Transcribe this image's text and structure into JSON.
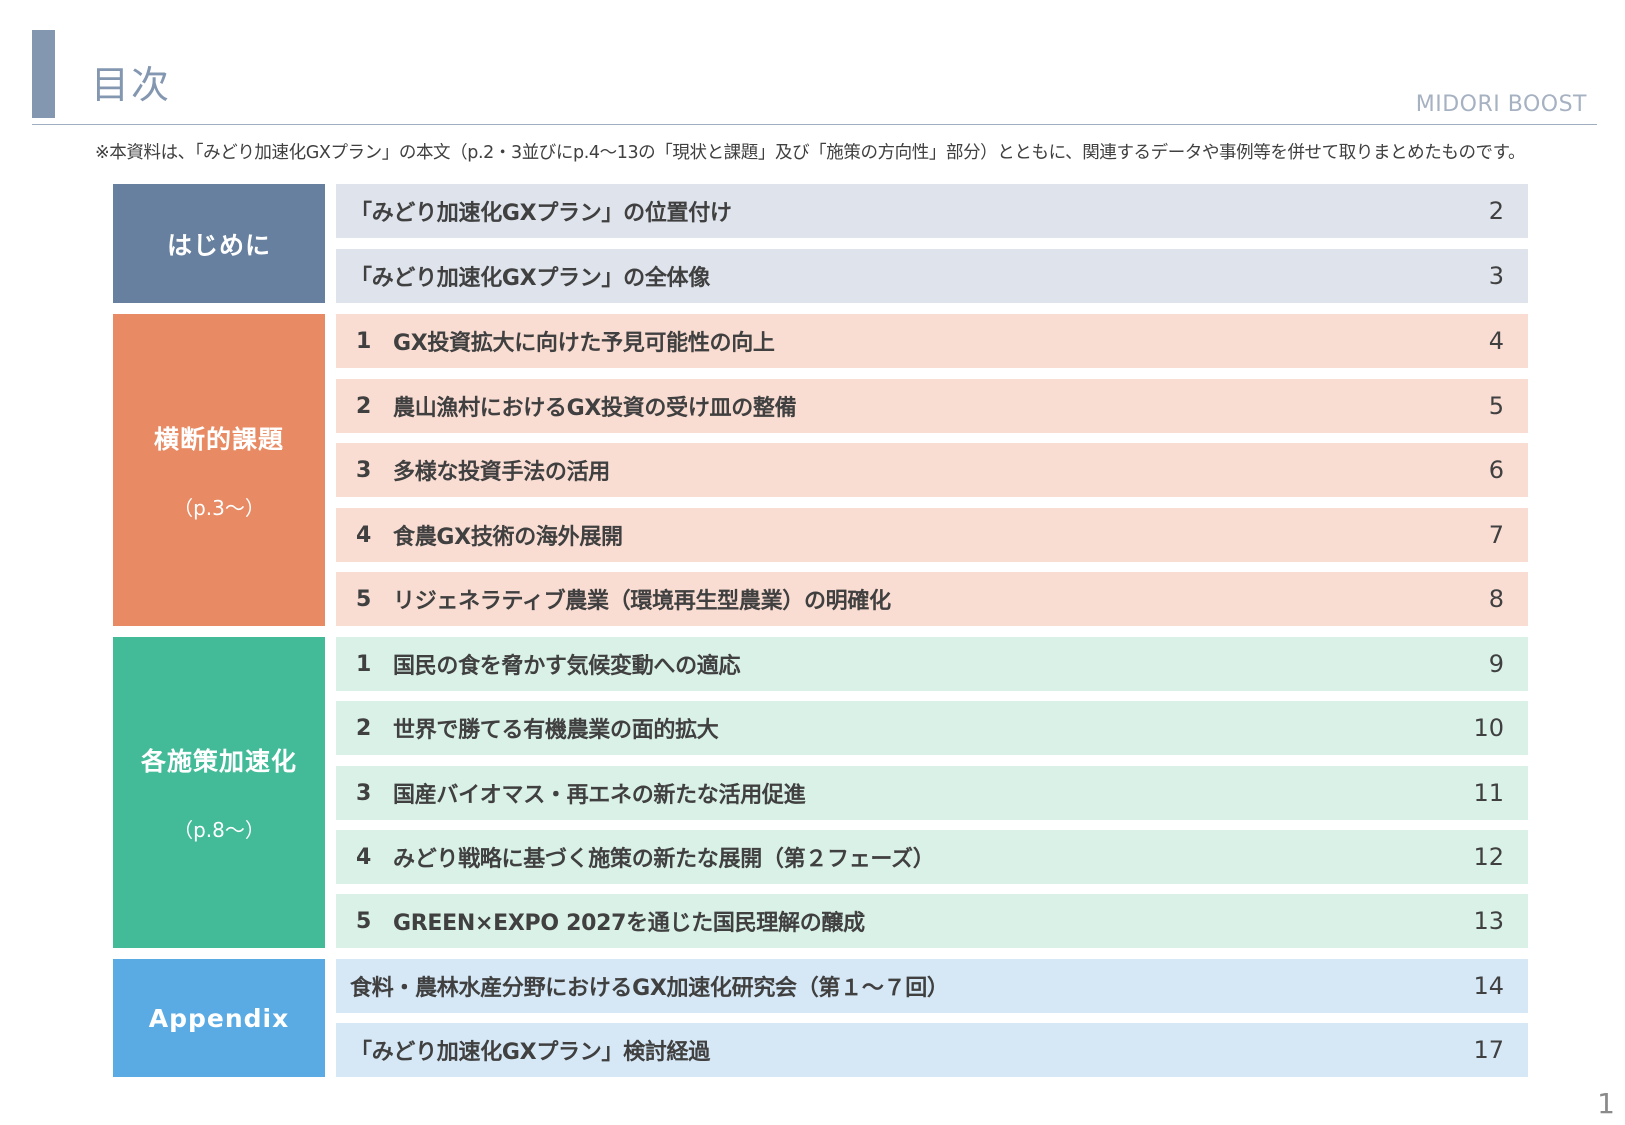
{
  "header": {
    "title": "目次",
    "brand": "MIDORI BOOST"
  },
  "note": "※本資料は、「みどり加速化GXプラン」の本文（p.2・3並びにp.4～13の「現状と課題」及び「施策の方向性」部分）とともに、関連するデータや事例等を併せて取りまとめたものです。",
  "sections": [
    {
      "label": "はじめに",
      "sub": "",
      "color": "#67809f",
      "row_bg": "#dee3ec",
      "items": [
        {
          "num": "",
          "text": "「みどり加速化GXプラン」の位置付け",
          "page": "2"
        },
        {
          "num": "",
          "text": "「みどり加速化GXプラン」の全体像",
          "page": "3"
        }
      ]
    },
    {
      "label": "横断的課題",
      "sub": "（p.3～）",
      "color": "#e88a63",
      "row_bg": "#f9ddd3",
      "items": [
        {
          "num": "1",
          "text": "GX投資拡大に向けた予見可能性の向上",
          "page": "4"
        },
        {
          "num": "2",
          "text": "農山漁村におけるGX投資の受け皿の整備",
          "page": "5"
        },
        {
          "num": "3",
          "text": "多様な投資手法の活用",
          "page": "6"
        },
        {
          "num": "4",
          "text": "食農GX技術の海外展開",
          "page": "7"
        },
        {
          "num": "5",
          "text": "リジェネラティブ農業（環境再生型農業）の明確化",
          "page": "8"
        }
      ]
    },
    {
      "label": "各施策加速化",
      "sub": "（p.8～）",
      "color": "#43bb98",
      "row_bg": "#daf1e8",
      "items": [
        {
          "num": "1",
          "text": "国民の食を脅かす気候変動への適応",
          "page": "9"
        },
        {
          "num": "2",
          "text": "世界で勝てる有機農業の面的拡大",
          "page": "10"
        },
        {
          "num": "3",
          "text": "国産バイオマス・再エネの新たな活用促進",
          "page": "11"
        },
        {
          "num": "4",
          "text": "みどり戦略に基づく施策の新たな展開（第２フェーズ）",
          "page": "12"
        },
        {
          "num": "5",
          "text": "GREEN×EXPO 2027を通じた国民理解の醸成",
          "page": "13"
        }
      ]
    },
    {
      "label": "Appendix",
      "sub": "",
      "color": "#5aabe4",
      "row_bg": "#d6e8f6",
      "items": [
        {
          "num": "",
          "text": "食料・農林水産分野におけるGX加速化研究会（第１～７回）",
          "page": "14"
        },
        {
          "num": "",
          "text": "「みどり加速化GXプラン」検討経過",
          "page": "17"
        }
      ]
    }
  ],
  "page_number": "1"
}
